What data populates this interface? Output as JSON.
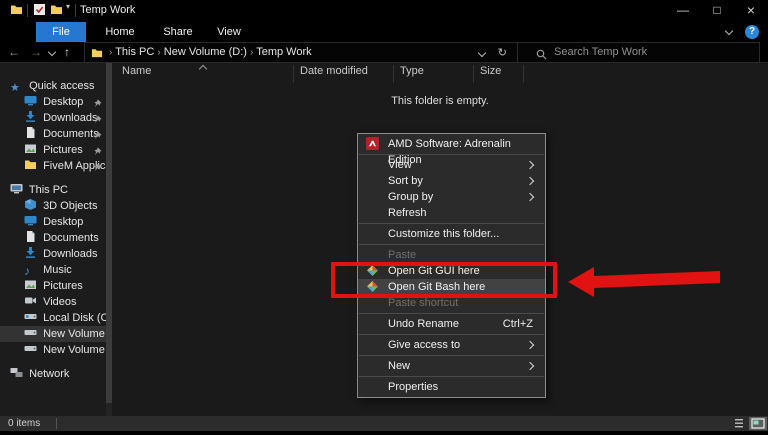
{
  "window": {
    "title": "Temp Work"
  },
  "glyphs": {
    "back": "←",
    "forward": "→",
    "up": "↑",
    "refresh": "↻",
    "breadcrumb_sep": "›",
    "minimize": "—",
    "maximize": "□",
    "close": "×",
    "help": "?",
    "qat_dropdown": "▾",
    "star": "★",
    "music": "♪"
  },
  "ribbon": {
    "tabs": [
      {
        "label": "File",
        "active": true
      },
      {
        "label": "Home"
      },
      {
        "label": "Share"
      },
      {
        "label": "View"
      }
    ]
  },
  "address_bar": {
    "breadcrumb": [
      "This PC",
      "New Volume (D:)",
      "Temp Work"
    ],
    "search_placeholder": "Search Temp Work"
  },
  "columns": {
    "headers": [
      "Name",
      "Date modified",
      "Type",
      "Size"
    ]
  },
  "content": {
    "empty_message": "This folder is empty."
  },
  "sidebar": {
    "quick_access": {
      "label": "Quick access",
      "items": [
        {
          "label": "Desktop",
          "pinned": true
        },
        {
          "label": "Downloads",
          "pinned": true
        },
        {
          "label": "Documents",
          "pinned": true
        },
        {
          "label": "Pictures",
          "pinned": true
        },
        {
          "label": "FiveM Applicatic",
          "pinned": true
        }
      ]
    },
    "this_pc": {
      "label": "This PC",
      "items": [
        {
          "label": "3D Objects"
        },
        {
          "label": "Desktop"
        },
        {
          "label": "Documents"
        },
        {
          "label": "Downloads"
        },
        {
          "label": "Music"
        },
        {
          "label": "Pictures"
        },
        {
          "label": "Videos"
        },
        {
          "label": "Local Disk (C:)"
        },
        {
          "label": "New Volume (D:)",
          "selected": true
        },
        {
          "label": "New Volume (G:)"
        }
      ]
    },
    "network": {
      "label": "Network"
    }
  },
  "context_menu": {
    "items": [
      {
        "label": "AMD Software: Adrenalin Edition",
        "icon": "amd"
      },
      {
        "type": "separator"
      },
      {
        "label": "View",
        "submenu": true
      },
      {
        "label": "Sort by",
        "submenu": true
      },
      {
        "label": "Group by",
        "submenu": true
      },
      {
        "label": "Refresh"
      },
      {
        "type": "separator"
      },
      {
        "label": "Customize this folder..."
      },
      {
        "type": "separator"
      },
      {
        "label": "Paste",
        "disabled": true
      },
      {
        "label": "Open Git GUI here",
        "icon": "git"
      },
      {
        "label": "Open Git Bash here",
        "icon": "git",
        "hover": true
      },
      {
        "label": "Paste shortcut",
        "disabled": true
      },
      {
        "type": "separator"
      },
      {
        "label": "Undo Rename",
        "shortcut": "Ctrl+Z"
      },
      {
        "type": "separator"
      },
      {
        "label": "Give access to",
        "submenu": true
      },
      {
        "type": "separator"
      },
      {
        "label": "New",
        "submenu": true
      },
      {
        "type": "separator"
      },
      {
        "label": "Properties"
      }
    ]
  },
  "status_bar": {
    "count": "0 items"
  },
  "annotation": {
    "highlight_color": "#e01212"
  }
}
